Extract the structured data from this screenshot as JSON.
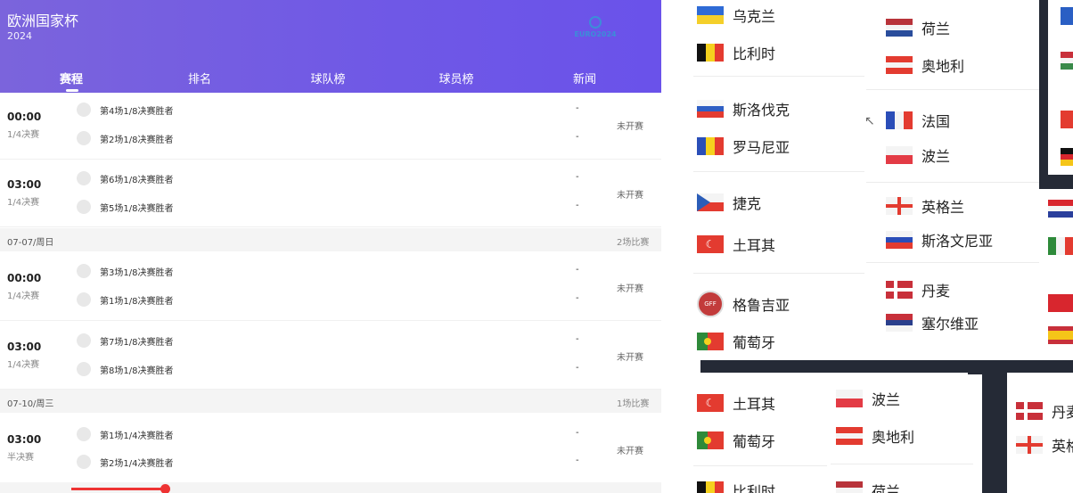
{
  "header": {
    "title": "欧洲国家杯",
    "year": "2024",
    "logo_text": "EURO2024"
  },
  "tabs": [
    {
      "label": "赛程"
    },
    {
      "label": "排名"
    },
    {
      "label": "球队榜"
    },
    {
      "label": "球员榜"
    },
    {
      "label": "新闻"
    }
  ],
  "matches": [
    {
      "time": "00:00",
      "round": "1/4决赛",
      "home": "第4场1/8决赛胜者",
      "away": "第2场1/8决赛胜者",
      "home_score": "-",
      "away_score": "-",
      "status": "未开赛"
    },
    {
      "time": "03:00",
      "round": "1/4决赛",
      "home": "第6场1/8决赛胜者",
      "away": "第5场1/8决赛胜者",
      "home_score": "-",
      "away_score": "-",
      "status": "未开赛"
    },
    {
      "time": "00:00",
      "round": "1/4决赛",
      "home": "第3场1/8决赛胜者",
      "away": "第1场1/8决赛胜者",
      "home_score": "-",
      "away_score": "-",
      "status": "未开赛"
    },
    {
      "time": "03:00",
      "round": "1/4决赛",
      "home": "第7场1/8决赛胜者",
      "away": "第8场1/8决赛胜者",
      "home_score": "-",
      "away_score": "-",
      "status": "未开赛"
    },
    {
      "time": "03:00",
      "round": "半决赛",
      "home": "第1场1/4决赛胜者",
      "away": "第2场1/4决赛胜者",
      "home_score": "-",
      "away_score": "-",
      "status": "未开赛"
    }
  ],
  "days": [
    {
      "date": "07-07/周日",
      "count": "2场比赛"
    },
    {
      "date": "07-10/周三",
      "count": "1场比赛"
    }
  ],
  "bracket": {
    "col1": [
      "乌克兰",
      "比利时",
      "斯洛伐克",
      "罗马尼亚",
      "捷克",
      "土耳其",
      "格鲁吉亚",
      "葡萄牙"
    ],
    "col2": [
      "荷兰",
      "奥地利",
      "法国",
      "波兰",
      "英格兰",
      "斯洛文尼亚",
      "丹麦",
      "塞尔维亚"
    ],
    "bottom1": [
      "土耳其",
      "葡萄牙",
      "比利时"
    ],
    "bottom2": [
      "波兰",
      "奥地利",
      "荷兰"
    ],
    "bottom3": [
      "丹麦",
      "英格"
    ]
  }
}
